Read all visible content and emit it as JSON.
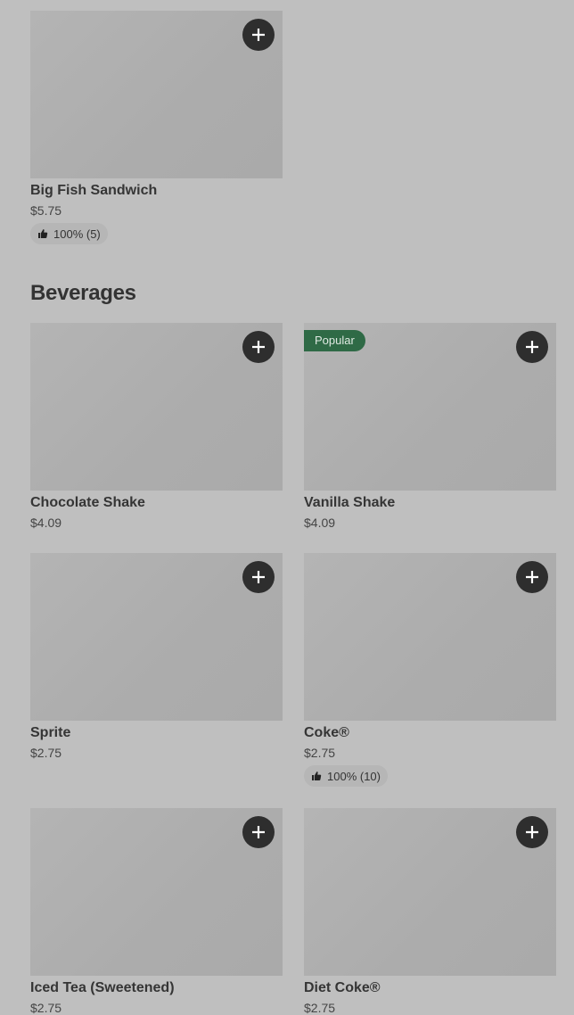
{
  "top_items": [
    {
      "name": "Big Fish Sandwich",
      "price": "$5.75",
      "rating": "100% (5)"
    }
  ],
  "section": {
    "title": "Beverages"
  },
  "beverages": [
    {
      "name": "Chocolate Shake",
      "price": "$4.09"
    },
    {
      "name": "Vanilla Shake",
      "price": "$4.09",
      "badge": "Popular"
    },
    {
      "name": "Sprite",
      "price": "$2.75"
    },
    {
      "name": "Coke®",
      "price": "$2.75",
      "rating": "100% (10)"
    },
    {
      "name": "Iced Tea (Sweetened)",
      "price": "$2.75"
    },
    {
      "name": "Diet Coke®",
      "price": "$2.75"
    }
  ],
  "icons": {
    "add": "plus-icon",
    "rating": "thumbs-up-icon"
  },
  "colors": {
    "background": "#bfbfbf",
    "button": "#2e2e2e",
    "popular_badge": "#2f6a46"
  }
}
